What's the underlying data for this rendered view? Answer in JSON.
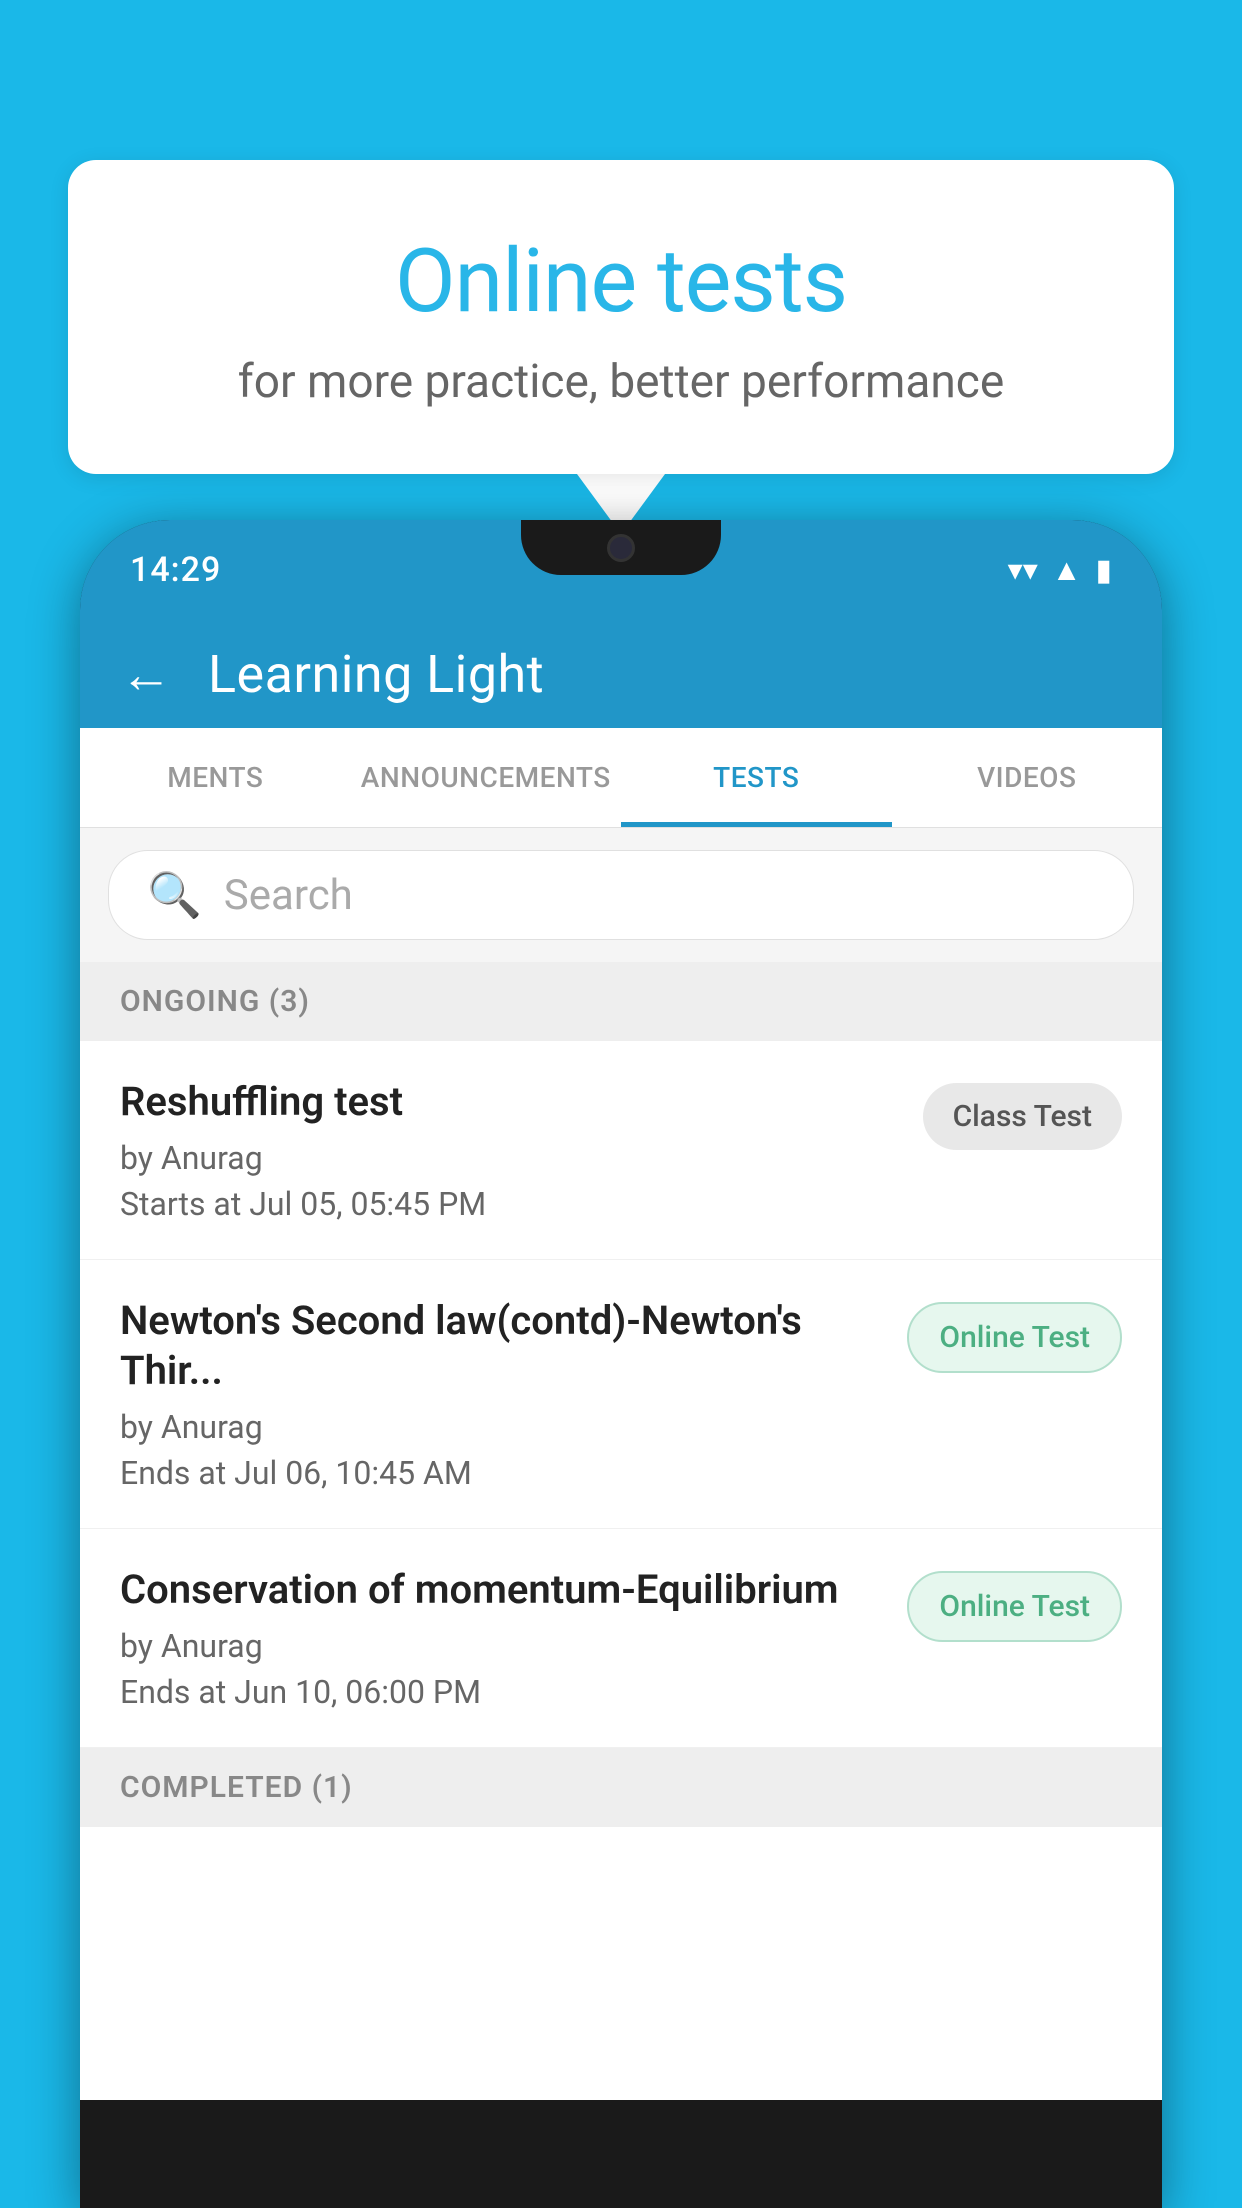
{
  "background": {
    "color": "#1ab8e8"
  },
  "speech_bubble": {
    "title": "Online tests",
    "subtitle": "for more practice, better performance"
  },
  "phone": {
    "status_bar": {
      "time": "14:29",
      "wifi": "▼",
      "signal": "▲",
      "battery": "▮"
    },
    "app_header": {
      "back_label": "←",
      "title": "Learning Light"
    },
    "tabs": [
      {
        "label": "MENTS",
        "active": false
      },
      {
        "label": "ANNOUNCEMENTS",
        "active": false
      },
      {
        "label": "TESTS",
        "active": true
      },
      {
        "label": "VIDEOS",
        "active": false
      }
    ],
    "search": {
      "placeholder": "Search",
      "icon": "🔍"
    },
    "sections": [
      {
        "title": "ONGOING (3)",
        "items": [
          {
            "name": "Reshuffling test",
            "author": "by Anurag",
            "date": "Starts at  Jul 05, 05:45 PM",
            "badge": "Class Test",
            "badge_type": "class"
          },
          {
            "name": "Newton's Second law(contd)-Newton's Thir...",
            "author": "by Anurag",
            "date": "Ends at  Jul 06, 10:45 AM",
            "badge": "Online Test",
            "badge_type": "online"
          },
          {
            "name": "Conservation of momentum-Equilibrium",
            "author": "by Anurag",
            "date": "Ends at  Jun 10, 06:00 PM",
            "badge": "Online Test",
            "badge_type": "online"
          }
        ]
      },
      {
        "title": "COMPLETED (1)",
        "items": []
      }
    ]
  }
}
